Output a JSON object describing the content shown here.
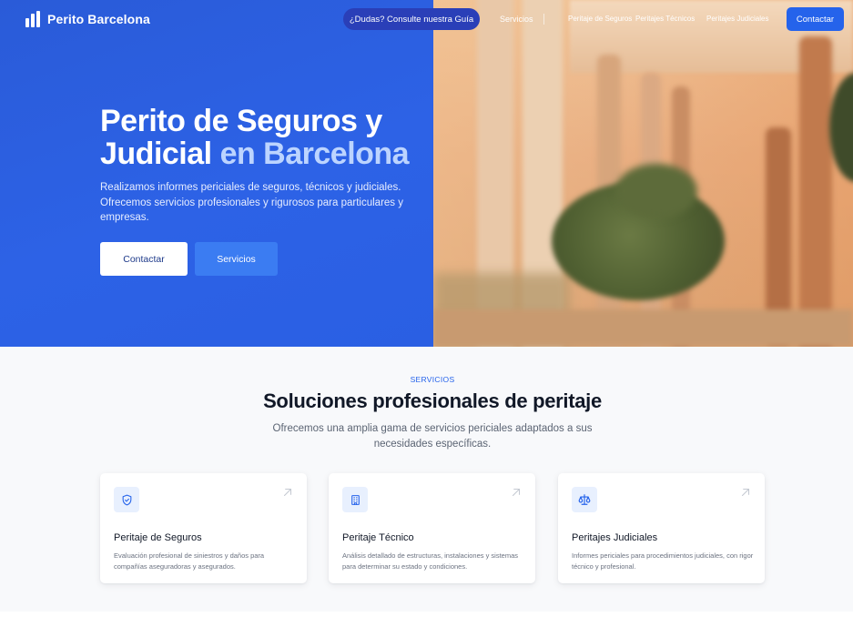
{
  "nav": {
    "brand": "Perito Barcelona",
    "guide_button": "¿Dudas? Consulte nuestra Guía",
    "links": [
      "Servicios",
      "Peritaje de Seguros",
      "Peritajes Técnicos",
      "Peritajes Judiciales"
    ],
    "contact_button": "Contactar"
  },
  "hero": {
    "title_line1": "Perito de Seguros y",
    "title_line2_plain": "Judicial ",
    "title_line2_accent": "en Barcelona",
    "description": "Realizamos informes periciales de seguros, técnicos y judiciales. Ofrecemos servicios profesionales y rigurosos para particulares y empresas.",
    "primary_button": "Contactar",
    "secondary_button": "Servicios"
  },
  "services": {
    "eyebrow": "SERVICIOS",
    "title": "Soluciones profesionales de peritaje",
    "subtitle": "Ofrecemos una amplia gama de servicios periciales adaptados a sus necesidades específicas.",
    "cards": [
      {
        "icon": "shield-icon",
        "title": "Peritaje de Seguros",
        "description": "Evaluación profesional de siniestros y daños para compañías aseguradoras y asegurados."
      },
      {
        "icon": "building-icon",
        "title": "Peritaje Técnico",
        "description": "Análisis detallado de estructuras, instalaciones y sistemas para determinar su estado y condiciones."
      },
      {
        "icon": "scale-icon",
        "title": "Peritajes Judiciales",
        "description": "Informes periciales para procedimientos judiciales, con rigor técnico y profesional."
      }
    ]
  },
  "colors": {
    "brand_blue": "#2563eb",
    "hero_blue": "#2d62e6",
    "accent_light": "#bcd4ff"
  }
}
